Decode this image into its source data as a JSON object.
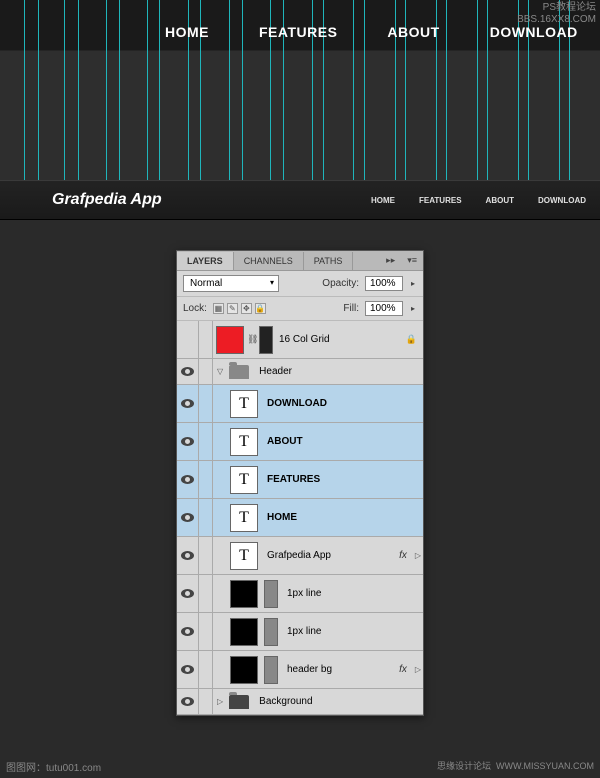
{
  "watermarks": {
    "top1": "PS教程论坛",
    "top2": "BBS.16XX8.COM",
    "bottom_left": "图图网：tutu001.com",
    "bottom_right1": "思缘设计论坛",
    "bottom_right2": "WWW.MISSYUAN.COM"
  },
  "top_nav": {
    "home": "HOME",
    "features": "FEATURES",
    "about": "ABOUT",
    "download": "DOWNLOAD"
  },
  "header": {
    "title": "Grafpedia App",
    "nav": {
      "home": "HOME",
      "features": "FEATURES",
      "about": "ABOUT",
      "download": "DOWNLOAD"
    }
  },
  "panel": {
    "tabs": {
      "layers": "LAYERS",
      "channels": "CHANNELS",
      "paths": "PATHS"
    },
    "blend_mode": "Normal",
    "opacity_label": "Opacity:",
    "opacity_value": "100%",
    "lock_label": "Lock:",
    "fill_label": "Fill:",
    "fill_value": "100%",
    "layers": {
      "grid": "16 Col Grid",
      "header_group": "Header",
      "download": "DOWNLOAD",
      "about": "ABOUT",
      "features": "FEATURES",
      "home": "HOME",
      "app": "Grafpedia App",
      "line1": "1px line",
      "line2": "1px line",
      "header_bg": "header bg",
      "background": "Background",
      "fx": "fx"
    }
  },
  "guides_x": [
    24,
    38,
    64,
    78,
    106,
    119,
    147,
    159,
    188,
    200,
    229,
    242,
    270,
    283,
    312,
    323,
    353,
    364,
    395,
    405,
    436,
    446,
    477,
    487,
    518,
    528,
    559,
    569
  ]
}
